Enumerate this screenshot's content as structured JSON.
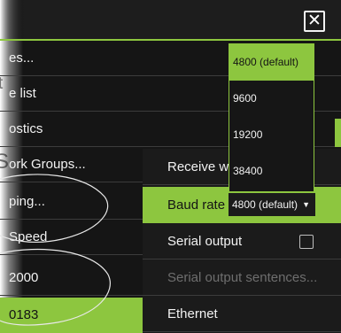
{
  "left_page": {
    "t_fragment": "t",
    "s_fragment": "S"
  },
  "menu": {
    "items": [
      {
        "label": "es..."
      },
      {
        "label": "e list"
      },
      {
        "label": "ostics"
      },
      {
        "label": "ork Groups..."
      },
      {
        "label": "ping..."
      },
      {
        "label": "Speed"
      },
      {
        "label": "2000"
      },
      {
        "label": "0183"
      }
    ]
  },
  "dialog": {
    "rows": {
      "receive": "Receive wa",
      "baud": "Baud rate",
      "serial_output": "Serial output",
      "serial_sentences": "Serial output sentences...",
      "ethernet": "Ethernet"
    },
    "baud_selected": "4800 (default)",
    "dropdown_arrow": "▼"
  },
  "dropdown": {
    "options": [
      "4800 (default)",
      "9600",
      "19200",
      "38400"
    ]
  },
  "titlebar": {
    "close_glyph": "✕"
  },
  "colors": {
    "accent": "#8dc63f",
    "background": "#151515",
    "text": "#f2f2f2"
  }
}
